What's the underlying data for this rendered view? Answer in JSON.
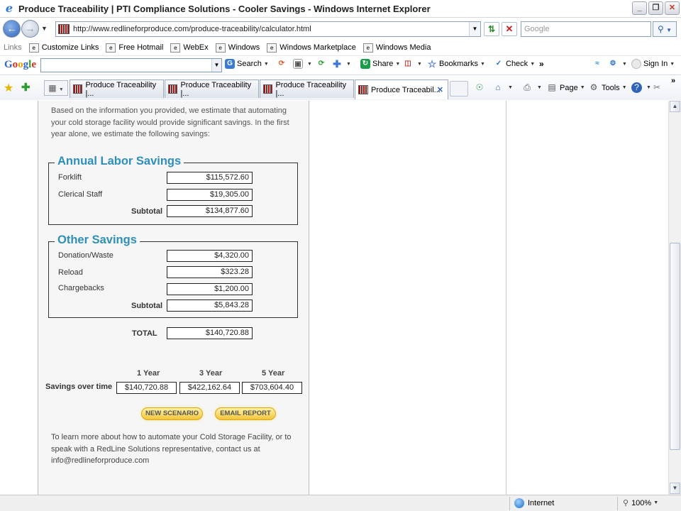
{
  "window": {
    "title": "Produce Traceability | PTI Compliance Solutions - Cooler Savings - Windows Internet Explorer",
    "min_label": "_",
    "max_label": "❐",
    "close_label": "✕"
  },
  "address": {
    "url": "http://www.redlineforproduce.com/produce-traceability/calculator.html",
    "search_placeholder": "Google"
  },
  "links_bar": {
    "label": "Links",
    "items": [
      "Customize Links",
      "Free Hotmail",
      "WebEx",
      "Windows",
      "Windows Marketplace",
      "Windows Media"
    ]
  },
  "google_bar": {
    "logo": [
      "G",
      "o",
      "o",
      "g",
      "l",
      "e"
    ],
    "search_label": "Search",
    "share_label": "Share",
    "bookmarks_label": "Bookmarks",
    "check_label": "Check",
    "more_label": "»",
    "signin_label": "Sign In"
  },
  "tabs": {
    "items": [
      {
        "label": "Produce Traceability |..."
      },
      {
        "label": "Produce Traceability |..."
      },
      {
        "label": "Produce Traceability |..."
      },
      {
        "label": "Produce Traceabil..."
      }
    ],
    "close_label": "✕"
  },
  "command_bar": {
    "page_label": "Page",
    "tools_label": "Tools",
    "more_label": "»"
  },
  "content": {
    "intro": "Based on the information you provided, we estimate that automating your cold storage facility would provide significant savings. In the first year alone, we estimate the following savings:",
    "annual_labor": {
      "title": "Annual Labor Savings",
      "rows": [
        {
          "label": "Forklift",
          "value": "$115,572.60"
        },
        {
          "label": "Clerical Staff",
          "value": "$19,305.00"
        }
      ],
      "subtotal_label": "Subtotal",
      "subtotal_value": "$134,877.60"
    },
    "other_savings": {
      "title": "Other Savings",
      "rows": [
        {
          "label": "Donation/Waste",
          "value": "$4,320.00"
        },
        {
          "label": "Reload",
          "value": "$323.28"
        },
        {
          "label": "Chargebacks",
          "value": "$1,200.00"
        }
      ],
      "subtotal_label": "Subtotal",
      "subtotal_value": "$5,843.28"
    },
    "total_label": "TOTAL",
    "total_value": "$140,720.88",
    "over_time": {
      "label": "Savings over time",
      "headers": [
        "1 Year",
        "3 Year",
        "5 Year"
      ],
      "values": [
        "$140,720.88",
        "$422,162.64",
        "$703,604.40"
      ]
    },
    "new_scenario_label": "NEW SCENARIO",
    "email_report_label": "EMAIL REPORT",
    "outro": "To learn more about how to automate your Cold Storage Facility, or to speak with a RedLine Solutions representative, contact us at info@redlineforproduce.com"
  },
  "status": {
    "zone": "Internet",
    "zoom": "100%"
  }
}
